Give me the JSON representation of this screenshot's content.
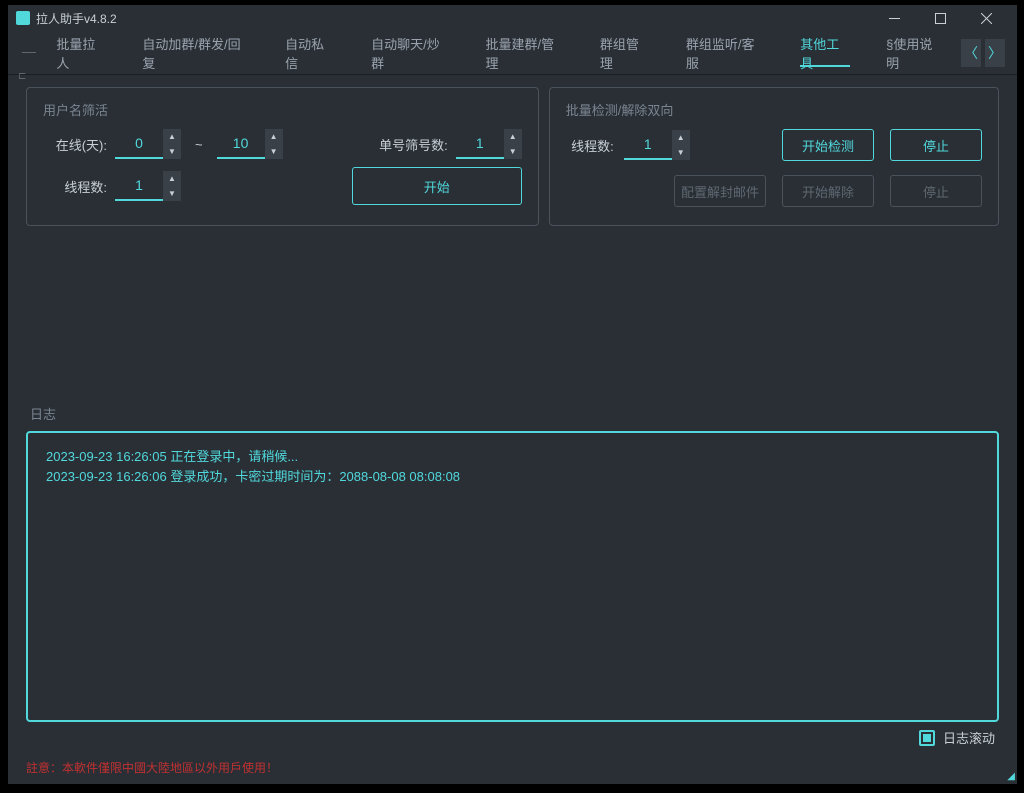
{
  "window": {
    "title": "拉人助手v4.8.2"
  },
  "tabs": {
    "items": [
      "批量拉人",
      "自动加群/群发/回复",
      "自动私信",
      "自动聊天/炒群",
      "批量建群/管理",
      "群组管理",
      "群组监听/客服",
      "其他工具",
      "§使用说明"
    ]
  },
  "panelLeft": {
    "title": "用户名筛活",
    "onlineLabel": "在线(天):",
    "onlineMin": "0",
    "onlineMax": "10",
    "singleLabel": "单号筛号数:",
    "singleValue": "1",
    "threadLabel": "线程数:",
    "threadValue": "1",
    "startBtn": "开始"
  },
  "panelRight": {
    "title": "批量检测/解除双向",
    "threadLabel": "线程数:",
    "threadValue": "1",
    "startDetectBtn": "开始检测",
    "stopBtn": "停止",
    "configBtn": "配置解封邮件",
    "startUnblockBtn": "开始解除",
    "stopBtn2": "停止"
  },
  "log": {
    "title": "日志",
    "lines": [
      "2023-09-23 16:26:05 正在登录中，请稍候...",
      "2023-09-23 16:26:06 登录成功，卡密过期时间为：2088-08-08 08:08:08"
    ],
    "scrollLabel": "日志滚动"
  },
  "warning": "註意：本軟件僅限中國大陸地區以外用戶使用！"
}
